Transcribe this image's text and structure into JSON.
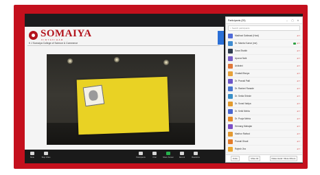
{
  "slide": {
    "brand": "SOMAIYA",
    "brand_sub": "VIDYAVIHAR",
    "college": "K J Somaiya College of Science & Commerce"
  },
  "participants_panel": {
    "title": "Participants (25)",
    "search_placeholder": "Search participants",
    "people": [
      {
        "name": "Madhavi Gaikwad (Host)",
        "color": "#4f6bd8",
        "video": false
      },
      {
        "name": "Dr. Mamta Kumar (me)",
        "color": "#3f8cd1",
        "video": true
      },
      {
        "name": "Sana Shaikh",
        "color": "#2f3b4e",
        "video": false
      },
      {
        "name": "Apurva Naik",
        "color": "#7a5fc7",
        "video": false
      },
      {
        "name": "Ashiwini",
        "color": "#e0783a",
        "video": false
      },
      {
        "name": "Chaitali Bhuiya",
        "color": "#e7a23b",
        "video": false
      },
      {
        "name": "Dr. Pranali Patil",
        "color": "#6d56c9",
        "video": false
      },
      {
        "name": "Dr. Rashmi Ranade",
        "color": "#4a79d1",
        "video": false
      },
      {
        "name": "Dr. Smita Shinde",
        "color": "#3a8fc7",
        "video": false
      },
      {
        "name": "Dr. Sonal Vaidya",
        "color": "#e39b2e",
        "video": false
      },
      {
        "name": "Dr. Ketki Mehta",
        "color": "#4a66d0",
        "video": false
      },
      {
        "name": "Dr. Pooja Mehta",
        "color": "#e58a2a",
        "video": false
      },
      {
        "name": "Hemang Mahajan",
        "color": "#7d4fc6",
        "video": false
      },
      {
        "name": "Madhur Rathod",
        "color": "#e49a32",
        "video": false
      },
      {
        "name": "Pranali Ghadi",
        "color": "#e47d2c",
        "video": false
      },
      {
        "name": "Rajesh Jha",
        "color": "#ecaa33",
        "video": false
      }
    ],
    "footer": {
      "invite": "Invite",
      "mute_all": "Mute All",
      "more": "Raise  Hand / Mute Others"
    }
  },
  "toolbar": {
    "mute": "Mute",
    "stop_video": "Stop Video",
    "participants": "Participants",
    "chat": "Chat",
    "share_screen": "Share Screen",
    "record": "Record",
    "reactions": "Reactions",
    "participant_count": "25"
  }
}
